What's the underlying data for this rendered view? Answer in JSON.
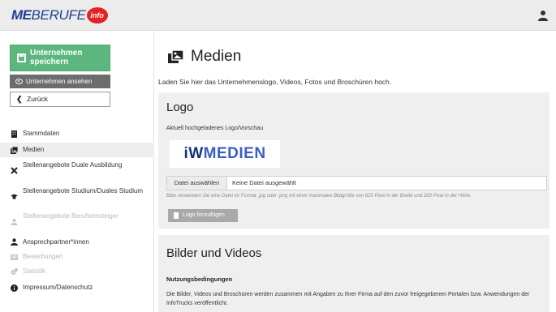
{
  "header": {
    "brand_me": "ME",
    "brand_berufe": "BERUFE",
    "brand_info": "info"
  },
  "sidebar": {
    "save_label": "Unternehmen speichern",
    "view_label": "Unternehmen ansehen",
    "back_label": "Zurück",
    "items": [
      {
        "label": "Stammdaten"
      },
      {
        "label": "Medien"
      },
      {
        "label": "Stellenangebote Duale Ausbildung"
      },
      {
        "label": "Stellenangebote Studium/Duales Studium"
      },
      {
        "label": "Stellenangebote Berufseinsteiger"
      },
      {
        "label": "Ansprechpartner*innen"
      },
      {
        "label": "Bewerbungen"
      },
      {
        "label": "Statistik"
      },
      {
        "label": "Impressum/Datenschutz"
      }
    ]
  },
  "main": {
    "title": "Medien",
    "intro": "Laden Sie hier das Unternehmenslogo, Videos, Fotos und Broschüren hoch.",
    "logo_panel": {
      "heading": "Logo",
      "current_label": "Aktuell hochgeladenes Logo/Vorschau",
      "preview_iw": "iW",
      "preview_medien": "MEDIEN",
      "file_button": "Datei auswählen",
      "file_name": "Keine Datei ausgewählt",
      "hint": "Bitte verwenden Sie eine Datei im Format .jpg oder .png mit einer maximalen Bildgröße von 625 Pixel in der Breite und 200 Pixel in der Höhe.",
      "add_button": "Logo hinzufügen"
    },
    "media_panel": {
      "heading": "Bilder und Videos",
      "terms_title": "Nutzungsbedingungen",
      "terms_text": "Die Bilder, Videos und Broschüren werden zusammen mit Angaben zu Ihrer Firma auf den zuvor freigegebenen Portalen bzw. Anwendungen der InfoTrucks veröffentlicht."
    }
  }
}
